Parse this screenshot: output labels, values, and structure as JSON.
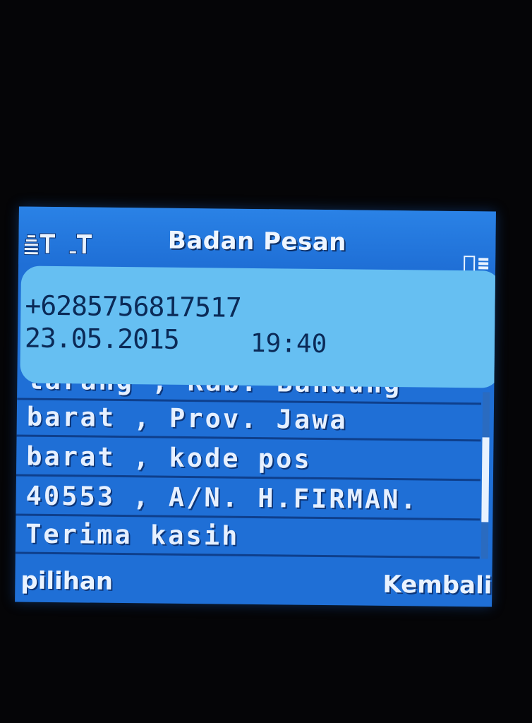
{
  "title": "Badan Pesan",
  "status": {
    "signal_icons": [
      "signal-sim1-icon",
      "signal-sim2-icon"
    ],
    "battery_icon": "battery-icon"
  },
  "header": {
    "sender": "+6285756817517",
    "date": "23.05.2015",
    "time": "19:40"
  },
  "message": {
    "lines": [
      "larang , Kab. Bandung",
      "barat , Prov. Jawa",
      "barat , kode pos",
      "40553 , A/N. H.FIRMAN.",
      "Terima kasih"
    ]
  },
  "scroll": {
    "position_fraction": 0.55
  },
  "softkeys": {
    "left": "pilihan",
    "right": "Kembali"
  },
  "colors": {
    "screen_bg": "#1f6fd6",
    "header_box": "#66bff2",
    "text_light": "#e6f0ff",
    "text_dark": "#0b2a57"
  }
}
